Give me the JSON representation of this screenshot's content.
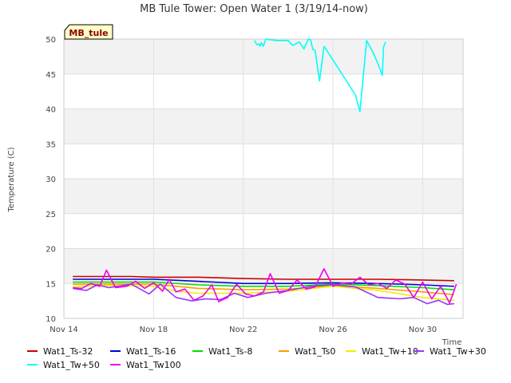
{
  "chart_data": {
    "type": "line",
    "title": "MB Tule Tower: Open Water 1 (3/19/14-now)",
    "badge": "MB_tule",
    "xlabel": "Time",
    "ylabel": "Temperature (C)",
    "x_ticks": [
      {
        "label": "Nov 14",
        "x": 14
      },
      {
        "label": "Nov 18",
        "x": 18
      },
      {
        "label": "Nov 22",
        "x": 22
      },
      {
        "label": "Nov 26",
        "x": 26
      },
      {
        "label": "Nov 30",
        "x": 30
      }
    ],
    "xlim": [
      14,
      31.8
    ],
    "ylim": [
      10,
      50
    ],
    "y_ticks": [
      10,
      15,
      20,
      25,
      30,
      35,
      40,
      45,
      50
    ],
    "grid": true,
    "band_color": "#f2f2f2",
    "series": [
      {
        "name": "Wat1_Ts-32",
        "color": "#cc0000",
        "x": [
          14.4,
          17,
          18,
          20,
          22,
          24,
          26,
          28,
          30,
          31.4
        ],
        "y": [
          16.0,
          16.0,
          15.9,
          15.9,
          15.7,
          15.6,
          15.6,
          15.6,
          15.5,
          15.4
        ]
      },
      {
        "name": "Wat1_Ts-16",
        "color": "#0000dd",
        "x": [
          14.4,
          16,
          18,
          20,
          22,
          24,
          26,
          28,
          30,
          31.4
        ],
        "y": [
          15.6,
          15.6,
          15.6,
          15.3,
          15.0,
          15.0,
          15.1,
          15.0,
          14.8,
          14.6
        ]
      },
      {
        "name": "Wat1_Ts-8",
        "color": "#00dd00",
        "x": [
          14.4,
          16,
          18,
          20,
          22,
          24,
          26,
          28,
          30,
          31.4
        ],
        "y": [
          15.2,
          15.2,
          15.2,
          14.8,
          14.6,
          14.6,
          14.9,
          14.7,
          14.4,
          14.1
        ]
      },
      {
        "name": "Wat1_Ts0",
        "color": "#ff9900",
        "x": [
          14.4,
          16,
          18,
          20,
          22,
          24,
          26,
          28,
          30,
          31.4
        ],
        "y": [
          14.9,
          14.9,
          14.9,
          14.3,
          14.1,
          14.2,
          14.7,
          14.3,
          13.8,
          13.4
        ]
      },
      {
        "name": "Wat1_Tw+10",
        "color": "#eeee00",
        "x": [
          14.4,
          16,
          18,
          19,
          20,
          22,
          24,
          26,
          28,
          30,
          31.4
        ],
        "y": [
          14.6,
          14.7,
          14.6,
          13.9,
          13.6,
          13.6,
          13.9,
          14.6,
          14.0,
          13.0,
          12.6
        ]
      },
      {
        "name": "Wat1_Tw+30",
        "color": "#9933ff",
        "x": [
          14.4,
          15,
          15.5,
          16,
          17,
          17.8,
          18.3,
          19,
          19.7,
          20.3,
          21,
          21.6,
          22.2,
          23,
          24,
          25,
          26,
          27,
          28,
          29,
          29.6,
          30.2,
          30.7,
          31.1,
          31.4
        ],
        "y": [
          14.3,
          14.0,
          14.8,
          14.4,
          14.9,
          13.5,
          14.9,
          13.0,
          12.5,
          12.8,
          12.7,
          13.6,
          13.0,
          13.6,
          14.0,
          14.6,
          14.8,
          14.5,
          13.0,
          12.8,
          13.0,
          12.1,
          12.6,
          12.0,
          12.1
        ]
      },
      {
        "name": "Wat1_Tw+50",
        "color": "#00ffff",
        "segments": [
          {
            "x": [
              22.5,
              22.6,
              22.7,
              22.75,
              22.8,
              22.9,
              23.0,
              23.5,
              24.0,
              24.2,
              24.5,
              24.7,
              24.9,
              25.0,
              25.1,
              25.2,
              25.4,
              25.6
            ],
            "y": [
              49.8,
              49.2,
              49.3,
              49.0,
              49.5,
              49.0,
              50.0,
              49.8,
              49.8,
              49.1,
              49.6,
              48.6,
              50.0,
              49.9,
              48.5,
              48.4,
              44.0,
              49.0
            ]
          },
          {
            "x": [
              25.6,
              27.0,
              27.2,
              27.5,
              27.8,
              28.0,
              28.2,
              28.25,
              28.3,
              28.35
            ],
            "y": [
              49.0,
              42.0,
              39.6,
              49.8,
              48.0,
              46.5,
              44.8,
              48.8,
              49.3,
              49.6
            ]
          }
        ]
      },
      {
        "name": "Wat1_Tw100",
        "color": "#ee00ee",
        "x": [
          14.4,
          14.8,
          15.2,
          15.6,
          15.9,
          16.3,
          16.8,
          17.2,
          17.6,
          18.0,
          18.4,
          18.7,
          19.0,
          19.4,
          19.8,
          20.2,
          20.6,
          20.9,
          21.3,
          21.7,
          22.1,
          22.5,
          22.9,
          23.2,
          23.6,
          24.0,
          24.4,
          24.8,
          25.2,
          25.6,
          26.0,
          26.4,
          26.8,
          27.2,
          27.6,
          28.0,
          28.4,
          28.8,
          29.2,
          29.6,
          30.0,
          30.4,
          30.8,
          31.2,
          31.5
        ],
        "y": [
          14.4,
          14.3,
          15.0,
          14.6,
          16.9,
          14.4,
          14.6,
          15.3,
          14.3,
          15.1,
          13.9,
          15.6,
          13.8,
          14.2,
          12.6,
          13.2,
          14.8,
          12.4,
          13.0,
          14.9,
          13.5,
          13.2,
          13.8,
          16.4,
          13.6,
          14.0,
          15.5,
          14.2,
          14.5,
          17.1,
          14.6,
          15.1,
          14.9,
          15.9,
          14.8,
          15.0,
          14.3,
          15.5,
          14.9,
          13.0,
          15.2,
          12.8,
          14.6,
          12.2,
          14.9
        ]
      }
    ]
  }
}
